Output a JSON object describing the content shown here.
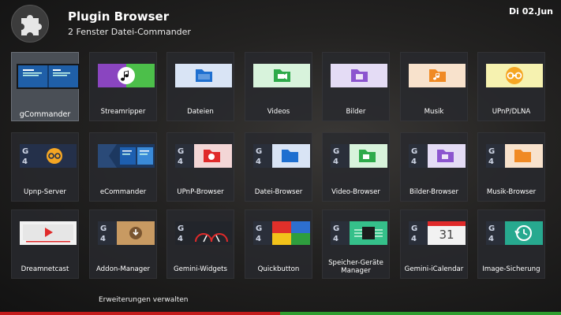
{
  "header": {
    "title": "Plugin Browser",
    "subtitle": "2 Fenster Datei-Commander",
    "datetime": "Di 02.Jun",
    "logo_icon": "puzzle-piece-icon"
  },
  "colors": {
    "selected_tile": "#4a4f56",
    "footer_red": "#c41c1c",
    "footer_green": "#2f9e2f"
  },
  "plugins": [
    {
      "label": "gCommander",
      "icon": "dual-pane-icon",
      "selected": true
    },
    {
      "label": "Streamripper",
      "icon": "music-note-icon"
    },
    {
      "label": "Dateien",
      "icon": "blue-folder-icon"
    },
    {
      "label": "Videos",
      "icon": "video-folder-icon"
    },
    {
      "label": "Bilder",
      "icon": "image-folder-icon"
    },
    {
      "label": "Musik",
      "icon": "music-folder-icon"
    },
    {
      "label": "UPnP/DLNA",
      "icon": "upnp-icon"
    },
    {
      "label": "Upnp-Server",
      "icon": "upnp-server-icon"
    },
    {
      "label": "eCommander",
      "icon": "ecommander-icon"
    },
    {
      "label": "UPnP-Browser",
      "icon": "upnp-folder-icon"
    },
    {
      "label": "Datei-Browser",
      "icon": "file-browser-icon"
    },
    {
      "label": "Video-Browser",
      "icon": "video-browser-icon"
    },
    {
      "label": "Bilder-Browser",
      "icon": "image-browser-icon"
    },
    {
      "label": "Musik-Browser",
      "icon": "music-browser-icon"
    },
    {
      "label": "Dreamnetcast",
      "icon": "play-video-icon"
    },
    {
      "label": "Addon-Manager",
      "icon": "download-addon-icon"
    },
    {
      "label": "Gemini-Widgets",
      "icon": "gauges-icon"
    },
    {
      "label": "Quickbutton",
      "icon": "color-buttons-icon"
    },
    {
      "label": "Speicher-Geräte Manager",
      "icon": "chip-icon"
    },
    {
      "label": "Gemini-iCalendar",
      "icon": "calendar-icon"
    },
    {
      "label": "Image-Sicherung",
      "icon": "backup-clock-icon"
    }
  ],
  "calendar_day": "31",
  "footer": {
    "manage_label": "Erweiterungen verwalten"
  }
}
